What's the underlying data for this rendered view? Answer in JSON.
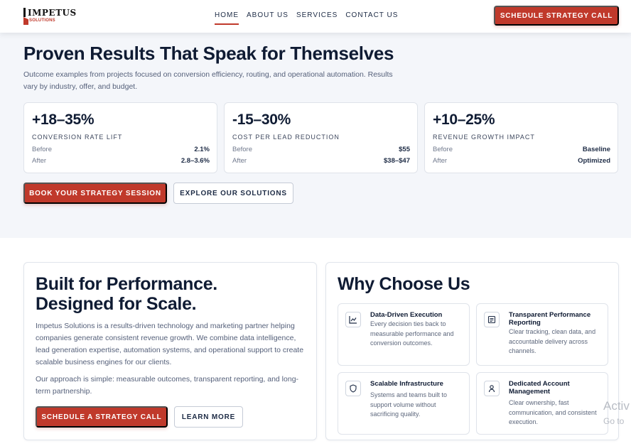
{
  "brand": {
    "name": "IMPETUS",
    "sub": "SOLUTIONS",
    "accent": "#c0392b",
    "navy": "#0f1b33"
  },
  "nav": {
    "links": [
      "HOME",
      "ABOUT US",
      "SERVICES",
      "CONTACT US"
    ],
    "active": "HOME",
    "cta": "SCHEDULE STRATEGY CALL"
  },
  "results": {
    "title": "Proven Results That Speak for Themselves",
    "subtitle": "Outcome examples from projects focused on conversion efficiency, routing, and operational automation. Results vary by industry, offer, and budget.",
    "stats": [
      {
        "value": "+18–35%",
        "label": "CONVERSION RATE LIFT",
        "before_label": "Before",
        "before": "2.1%",
        "after_label": "After",
        "after": "2.8–3.6%"
      },
      {
        "value": "-15–30%",
        "label": "COST PER LEAD REDUCTION",
        "before_label": "Before",
        "before": "$55",
        "after_label": "After",
        "after": "$38–$47"
      },
      {
        "value": "+10–25%",
        "label": "REVENUE GROWTH IMPACT",
        "before_label": "Before",
        "before": "Baseline",
        "after_label": "After",
        "after": "Optimized"
      }
    ],
    "primary_button": "BOOK YOUR STRATEGY SESSION",
    "secondary_button": "EXPLORE OUR SOLUTIONS"
  },
  "performance": {
    "title_line1": "Built for Performance.",
    "title_line2": "Designed for Scale.",
    "p1": "Impetus Solutions is a results-driven technology and marketing partner helping companies generate consistent revenue growth. We combine data intelligence, lead generation expertise, automation systems, and operational support to create scalable business engines for our clients.",
    "p2": "Our approach is simple: measurable outcomes, transparent reporting, and long-term partnership.",
    "primary_button": "SCHEDULE A STRATEGY CALL",
    "secondary_button": "LEARN MORE"
  },
  "why": {
    "title": "Why Choose Us",
    "features": [
      {
        "icon": "chart-line-icon",
        "title": "Data-Driven Execution",
        "desc": "Every decision ties back to measurable performance and conversion outcomes."
      },
      {
        "icon": "report-icon",
        "title": "Transparent Performance Reporting",
        "desc": "Clear tracking, clean data, and accountable delivery across channels."
      },
      {
        "icon": "shield-icon",
        "title": "Scalable Infrastructure",
        "desc": "Systems and teams built to support volume without sacrificing quality."
      },
      {
        "icon": "user-icon",
        "title": "Dedicated Account Management",
        "desc": "Clear ownership, fast communication, and consistent execution."
      }
    ]
  },
  "os_watermark": {
    "line1": "Activ",
    "line2": "Go to"
  }
}
